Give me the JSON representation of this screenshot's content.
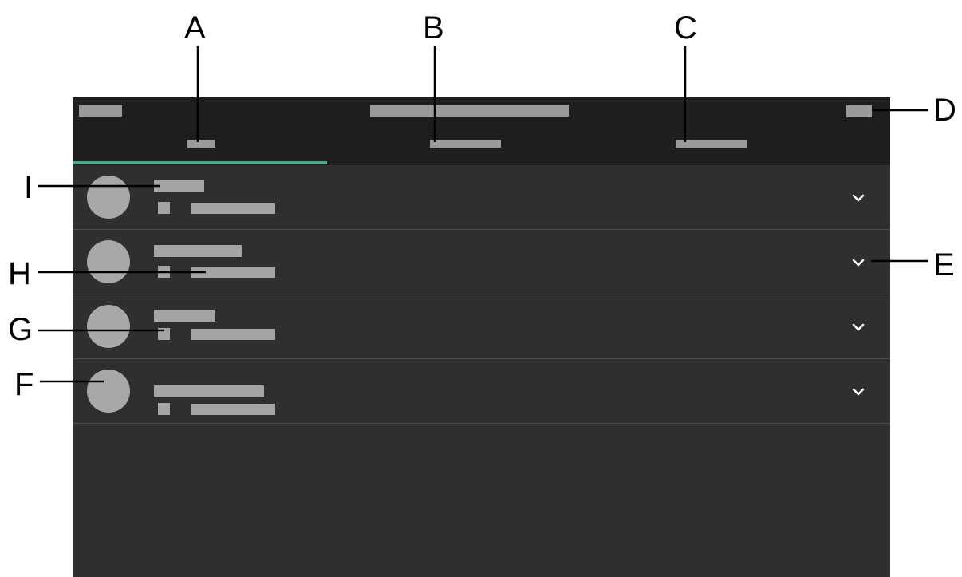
{
  "callouts": {
    "a": "A",
    "b": "B",
    "c": "C",
    "d": "D",
    "e": "E",
    "f": "F",
    "g": "G",
    "h": "H",
    "i": "I"
  },
  "colors": {
    "appbar": "#1e1e1e",
    "list_background": "#2f2f2f",
    "placeholder": "#9a9a9a",
    "tab_indicator": "#4aa88e",
    "divider": "#4a4a4a"
  },
  "app_bar": {
    "left_icon": "menu-placeholder-icon",
    "right_icon": "action-placeholder-icon"
  },
  "tabs": [
    {
      "callout": "A",
      "selected": true
    },
    {
      "callout": "B",
      "selected": false
    },
    {
      "callout": "C",
      "selected": false
    }
  ],
  "list_items": [
    {
      "callout": "I",
      "avatar_icon": "avatar-circle-icon",
      "chevron_icon": "chevron-down-icon"
    },
    {
      "callout": "H",
      "avatar_icon": "avatar-circle-icon",
      "chevron_icon": "chevron-down-icon"
    },
    {
      "callout": "G",
      "avatar_icon": "avatar-circle-icon",
      "chevron_icon": "chevron-down-icon"
    },
    {
      "callout": "F",
      "avatar_icon": "avatar-circle-icon",
      "chevron_icon": "chevron-down-icon"
    }
  ]
}
